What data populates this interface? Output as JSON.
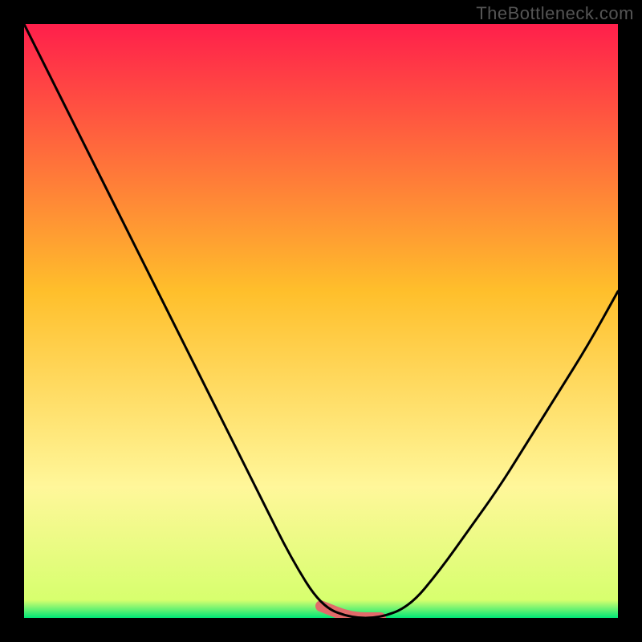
{
  "watermark": "TheBottleneck.com",
  "chart_data": {
    "type": "line",
    "title": "",
    "xlabel": "",
    "ylabel": "",
    "x": [
      0.0,
      0.05,
      0.1,
      0.15,
      0.2,
      0.25,
      0.3,
      0.35,
      0.4,
      0.45,
      0.5,
      0.55,
      0.6,
      0.65,
      0.7,
      0.75,
      0.8,
      0.85,
      0.9,
      0.95,
      1.0
    ],
    "values": [
      1.0,
      0.9,
      0.8,
      0.7,
      0.6,
      0.5,
      0.4,
      0.3,
      0.2,
      0.1,
      0.02,
      0.0,
      0.0,
      0.02,
      0.08,
      0.15,
      0.22,
      0.3,
      0.38,
      0.46,
      0.55
    ],
    "xlim": [
      0,
      1
    ],
    "ylim": [
      0,
      1
    ],
    "highlight_range_x": [
      0.48,
      0.64
    ],
    "colors": {
      "curve": "#000000",
      "highlight": "#e26a6a",
      "gradient_top": "#ff1f4b",
      "gradient_mid": "#ffbf2b",
      "gradient_low": "#fff79a",
      "gradient_bottom": "#00e676"
    }
  }
}
